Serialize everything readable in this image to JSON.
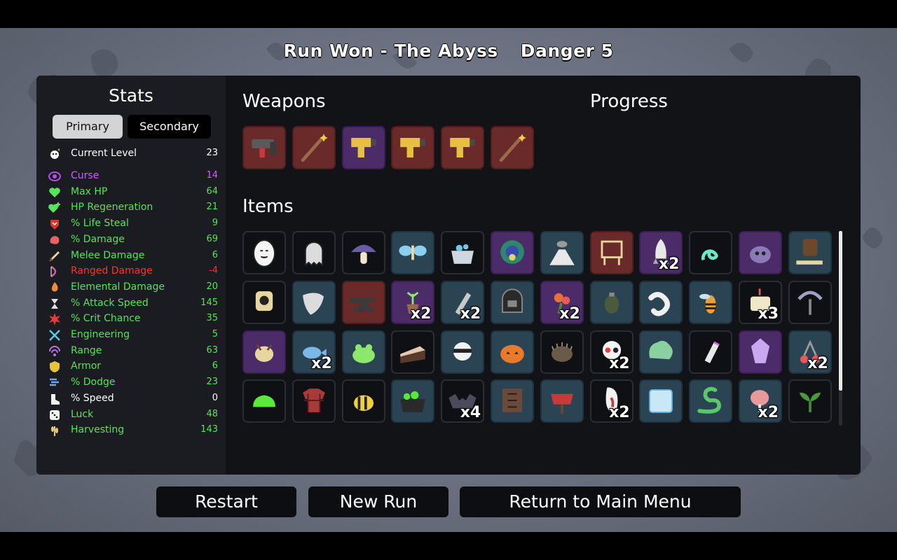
{
  "header": {
    "title": "Run Won - The Abyss",
    "danger": "Danger 5"
  },
  "stats": {
    "title": "Stats",
    "tabs": {
      "primary": "Primary",
      "secondary": "Secondary"
    },
    "rows": [
      {
        "label": "Current Level",
        "value": "23",
        "color": "#ffffff",
        "icon": "level-icon"
      },
      {
        "label": "Curse",
        "value": "14",
        "color": "#c862ff",
        "icon": "curse-icon"
      },
      {
        "label": "Max HP",
        "value": "64",
        "color": "#57e35a",
        "icon": "heart-icon"
      },
      {
        "label": "HP Regeneration",
        "value": "21",
        "color": "#57e35a",
        "icon": "regen-icon"
      },
      {
        "label": "% Life Steal",
        "value": "9",
        "color": "#57e35a",
        "icon": "lifesteal-icon"
      },
      {
        "label": "% Damage",
        "value": "69",
        "color": "#57e35a",
        "icon": "damage-icon"
      },
      {
        "label": "Melee Damage",
        "value": "6",
        "color": "#57e35a",
        "icon": "sword-icon"
      },
      {
        "label": "Ranged Damage",
        "value": "-4",
        "color": "#ff3030",
        "icon": "bow-icon"
      },
      {
        "label": "Elemental Damage",
        "value": "20",
        "color": "#57e35a",
        "icon": "fire-icon"
      },
      {
        "label": "% Attack Speed",
        "value": "145",
        "color": "#57e35a",
        "icon": "hourglass-icon"
      },
      {
        "label": "% Crit Chance",
        "value": "35",
        "color": "#57e35a",
        "icon": "crit-icon"
      },
      {
        "label": "Engineering",
        "value": "5",
        "color": "#57e35a",
        "icon": "wrench-icon"
      },
      {
        "label": "Range",
        "value": "63",
        "color": "#57e35a",
        "icon": "range-icon"
      },
      {
        "label": "Armor",
        "value": "6",
        "color": "#57e35a",
        "icon": "shield-icon"
      },
      {
        "label": "% Dodge",
        "value": "23",
        "color": "#57e35a",
        "icon": "dodge-icon"
      },
      {
        "label": "% Speed",
        "value": "0",
        "color": "#ffffff",
        "icon": "boot-icon"
      },
      {
        "label": "Luck",
        "value": "48",
        "color": "#57e35a",
        "icon": "dice-icon"
      },
      {
        "label": "Harvesting",
        "value": "143",
        "color": "#57e35a",
        "icon": "wheat-icon"
      }
    ]
  },
  "weapons": {
    "title": "Weapons",
    "list": [
      {
        "name": "smg",
        "tier": 3
      },
      {
        "name": "wand",
        "tier": 3
      },
      {
        "name": "taser",
        "tier": 2
      },
      {
        "name": "taser",
        "tier": 3
      },
      {
        "name": "taser",
        "tier": 3
      },
      {
        "name": "wand",
        "tier": 3
      }
    ]
  },
  "progress": {
    "title": "Progress"
  },
  "items": {
    "title": "Items",
    "list": [
      {
        "name": "egg",
        "tier": 0,
        "qty": ""
      },
      {
        "name": "ghost",
        "tier": 0,
        "qty": ""
      },
      {
        "name": "mushroom",
        "tier": 0,
        "qty": ""
      },
      {
        "name": "butterfly",
        "tier": 1,
        "qty": ""
      },
      {
        "name": "cauldron-pot",
        "tier": 0,
        "qty": ""
      },
      {
        "name": "peacock",
        "tier": 2,
        "qty": ""
      },
      {
        "name": "volcano",
        "tier": 1,
        "qty": ""
      },
      {
        "name": "robot-frame",
        "tier": 3,
        "qty": ""
      },
      {
        "name": "rocket",
        "tier": 2,
        "qty": "x2"
      },
      {
        "name": "spiral-snake",
        "tier": 0,
        "qty": ""
      },
      {
        "name": "purple-blob",
        "tier": 2,
        "qty": ""
      },
      {
        "name": "stump",
        "tier": 1,
        "qty": ""
      },
      {
        "name": "turret",
        "tier": 0,
        "qty": ""
      },
      {
        "name": "claw",
        "tier": 1,
        "qty": ""
      },
      {
        "name": "anvil",
        "tier": 3,
        "qty": ""
      },
      {
        "name": "potted-plant",
        "tier": 2,
        "qty": "x2"
      },
      {
        "name": "missile",
        "tier": 1,
        "qty": "x2"
      },
      {
        "name": "helmet",
        "tier": 1,
        "qty": ""
      },
      {
        "name": "bouquet",
        "tier": 2,
        "qty": "x2"
      },
      {
        "name": "grenade",
        "tier": 1,
        "qty": ""
      },
      {
        "name": "worm",
        "tier": 1,
        "qty": ""
      },
      {
        "name": "wasp",
        "tier": 1,
        "qty": ""
      },
      {
        "name": "scroll",
        "tier": 0,
        "qty": "x3"
      },
      {
        "name": "tree",
        "tier": 0,
        "qty": ""
      },
      {
        "name": "chicken",
        "tier": 2,
        "qty": ""
      },
      {
        "name": "fish",
        "tier": 1,
        "qty": "x2"
      },
      {
        "name": "frog",
        "tier": 1,
        "qty": ""
      },
      {
        "name": "cake",
        "tier": 0,
        "qty": ""
      },
      {
        "name": "ninja",
        "tier": 1,
        "qty": ""
      },
      {
        "name": "pumpkin",
        "tier": 1,
        "qty": ""
      },
      {
        "name": "hedgehog",
        "tier": 0,
        "qty": ""
      },
      {
        "name": "skull",
        "tier": 0,
        "qty": "x2"
      },
      {
        "name": "lettuce",
        "tier": 1,
        "qty": ""
      },
      {
        "name": "bullet",
        "tier": 0,
        "qty": ""
      },
      {
        "name": "crystal",
        "tier": 2,
        "qty": ""
      },
      {
        "name": "cherry-bomb",
        "tier": 1,
        "qty": "x2"
      },
      {
        "name": "slime",
        "tier": 0,
        "qty": ""
      },
      {
        "name": "plaid-shirt",
        "tier": 0,
        "qty": ""
      },
      {
        "name": "bee",
        "tier": 0,
        "qty": ""
      },
      {
        "name": "witch-cauldron",
        "tier": 1,
        "qty": ""
      },
      {
        "name": "bat",
        "tier": 0,
        "qty": "x4"
      },
      {
        "name": "leather-armor",
        "tier": 1,
        "qty": ""
      },
      {
        "name": "scarecrow",
        "tier": 1,
        "qty": ""
      },
      {
        "name": "fang",
        "tier": 0,
        "qty": "x2"
      },
      {
        "name": "ice-cube",
        "tier": 1,
        "qty": ""
      },
      {
        "name": "snake",
        "tier": 1,
        "qty": ""
      },
      {
        "name": "ham",
        "tier": 1,
        "qty": "x2"
      },
      {
        "name": "sprout",
        "tier": 0,
        "qty": ""
      }
    ]
  },
  "buttons": {
    "restart": "Restart",
    "new_run": "New Run",
    "main_menu": "Return to Main Menu"
  },
  "colors": {
    "tier0": "#0f1013",
    "tier1": "#2b4453",
    "tier2": "#4b2c69",
    "tier3": "#6b2a2a",
    "positive": "#57e35a",
    "negative": "#ff3030",
    "curse": "#c862ff"
  }
}
